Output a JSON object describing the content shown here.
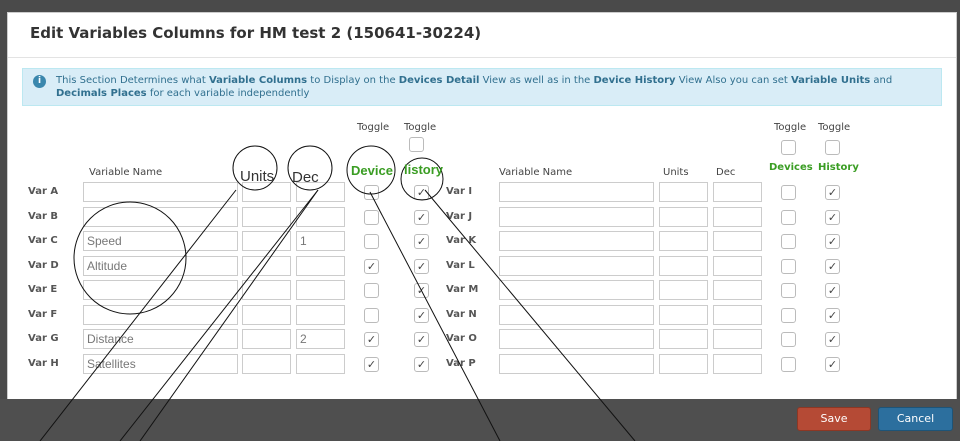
{
  "modal": {
    "title": "Edit Variables Columns for HM test 2 (150641-30224)"
  },
  "info": {
    "p1": "This Section Determines what ",
    "b1": "Variable Columns",
    "p2": " to Display on the ",
    "b2": "Devices Detail",
    "p3": " View as well as in the ",
    "b3": "Device History",
    "p4": " View Also you can set ",
    "b4": "Variable Units",
    "p5": " and ",
    "b5": "Decimals Places",
    "p6": " for each variable independently"
  },
  "headers": {
    "toggle": "Toggle",
    "variable_name": "Variable Name",
    "units": "Units",
    "dec": "Dec",
    "devices": "Devices",
    "history": "History",
    "units_zoom": "Units",
    "dec_zoom": "Dec",
    "device_zoom": "Device",
    "history_zoom": "listory"
  },
  "left_rows": [
    {
      "label": "Var A",
      "name": "",
      "units": "",
      "dec": "",
      "device": false,
      "history": true
    },
    {
      "label": "Var B",
      "name": "",
      "units": "",
      "dec": "",
      "device": false,
      "history": true
    },
    {
      "label": "Var C",
      "name": "Speed",
      "units": "",
      "dec": "1",
      "device": false,
      "history": true
    },
    {
      "label": "Var D",
      "name": "Altitude",
      "units": "",
      "dec": "",
      "device": true,
      "history": true
    },
    {
      "label": "Var E",
      "name": "",
      "units": "",
      "dec": "",
      "device": false,
      "history": true
    },
    {
      "label": "Var F",
      "name": "",
      "units": "",
      "dec": "",
      "device": false,
      "history": true
    },
    {
      "label": "Var G",
      "name": "Distance",
      "units": "",
      "dec": "2",
      "device": true,
      "history": true
    },
    {
      "label": "Var H",
      "name": "Satellites",
      "units": "",
      "dec": "",
      "device": true,
      "history": true
    }
  ],
  "right_rows": [
    {
      "label": "Var I",
      "name": "",
      "units": "",
      "dec": "",
      "device": false,
      "history": true
    },
    {
      "label": "Var J",
      "name": "",
      "units": "",
      "dec": "",
      "device": false,
      "history": true
    },
    {
      "label": "Var K",
      "name": "",
      "units": "",
      "dec": "",
      "device": false,
      "history": true
    },
    {
      "label": "Var L",
      "name": "",
      "units": "",
      "dec": "",
      "device": false,
      "history": true
    },
    {
      "label": "Var M",
      "name": "",
      "units": "",
      "dec": "",
      "device": false,
      "history": true
    },
    {
      "label": "Var N",
      "name": "",
      "units": "",
      "dec": "",
      "device": false,
      "history": true
    },
    {
      "label": "Var O",
      "name": "",
      "units": "",
      "dec": "",
      "device": false,
      "history": true
    },
    {
      "label": "Var P",
      "name": "",
      "units": "",
      "dec": "",
      "device": false,
      "history": true
    }
  ],
  "footer": {
    "save": "Save",
    "cancel": "Cancel"
  },
  "colors": {
    "green": "#3a9d23",
    "save": "#b54a35",
    "cancel": "#2c6f9e",
    "info_bg": "#d9edf7"
  }
}
